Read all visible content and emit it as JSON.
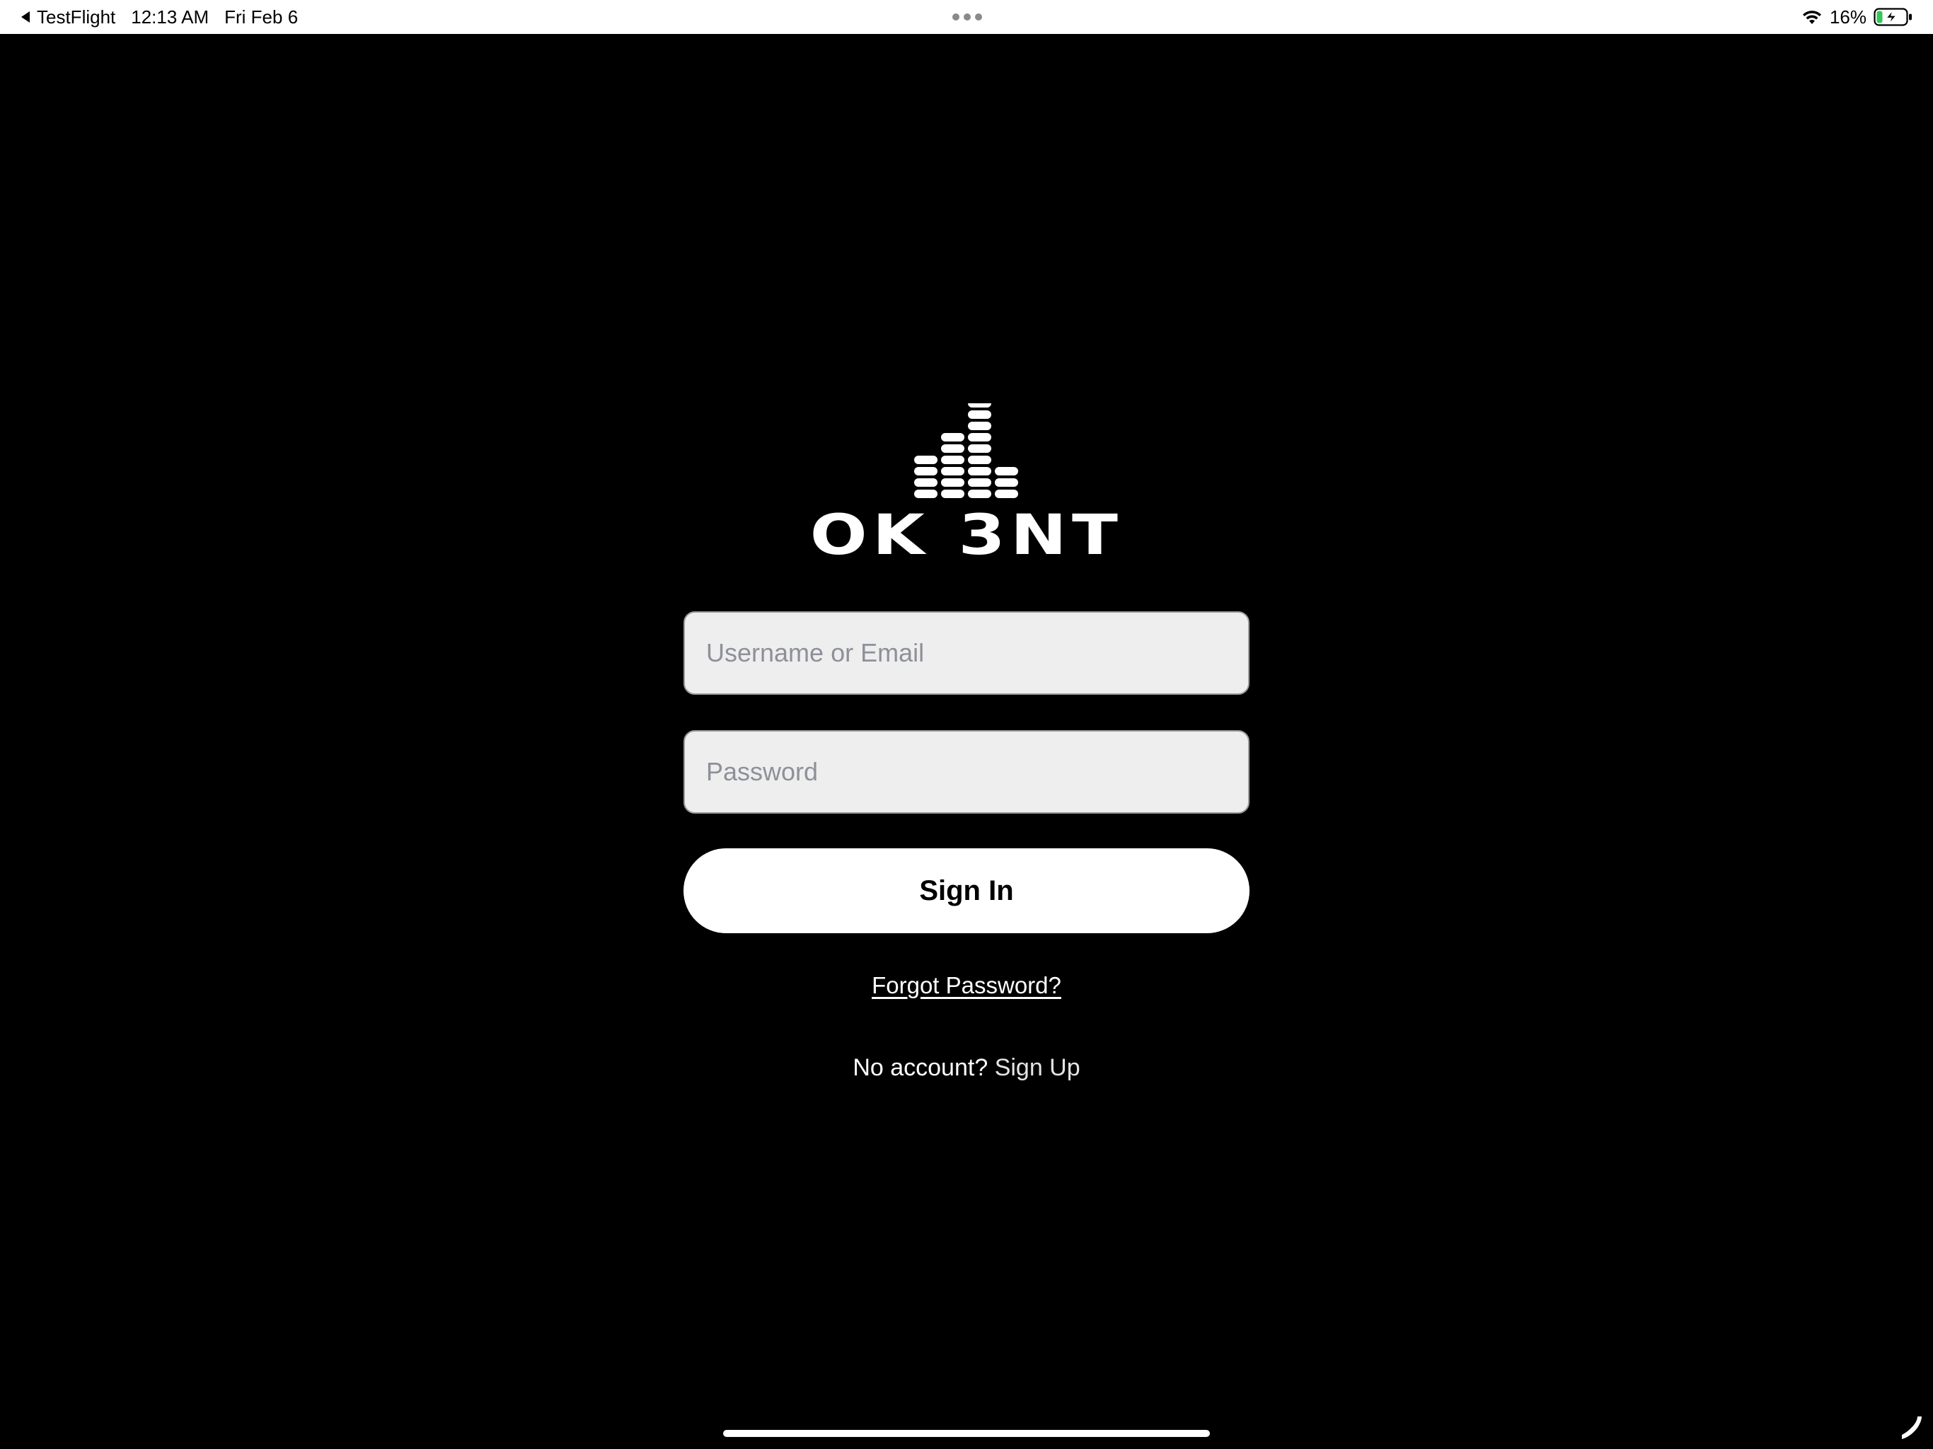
{
  "status_bar": {
    "back_app": "TestFlight",
    "time": "12:13 AM",
    "date": "Fri Feb 6",
    "battery": "16%",
    "icons": [
      "back-triangle-icon",
      "multitask-dots-icon",
      "wifi-icon",
      "battery-charging-icon"
    ]
  },
  "logo": {
    "text": "OK 3NT",
    "icon": "equalizer-bars-logo"
  },
  "form": {
    "username_placeholder": "Username or Email",
    "username_value": "",
    "password_placeholder": "Password",
    "password_value": "",
    "signin_label": "Sign In",
    "forgot_label": "Forgot Password?",
    "no_account_label": "No account?",
    "signup_label": "Sign Up"
  },
  "colors": {
    "background": "#000000",
    "status_bar_bg": "#ffffff",
    "field_bg": "#eeeeee",
    "placeholder": "#8e9099",
    "button_bg": "#ffffff",
    "battery_charge": "#34c759"
  },
  "icons": [
    "phone-icon",
    "home-indicator"
  ]
}
